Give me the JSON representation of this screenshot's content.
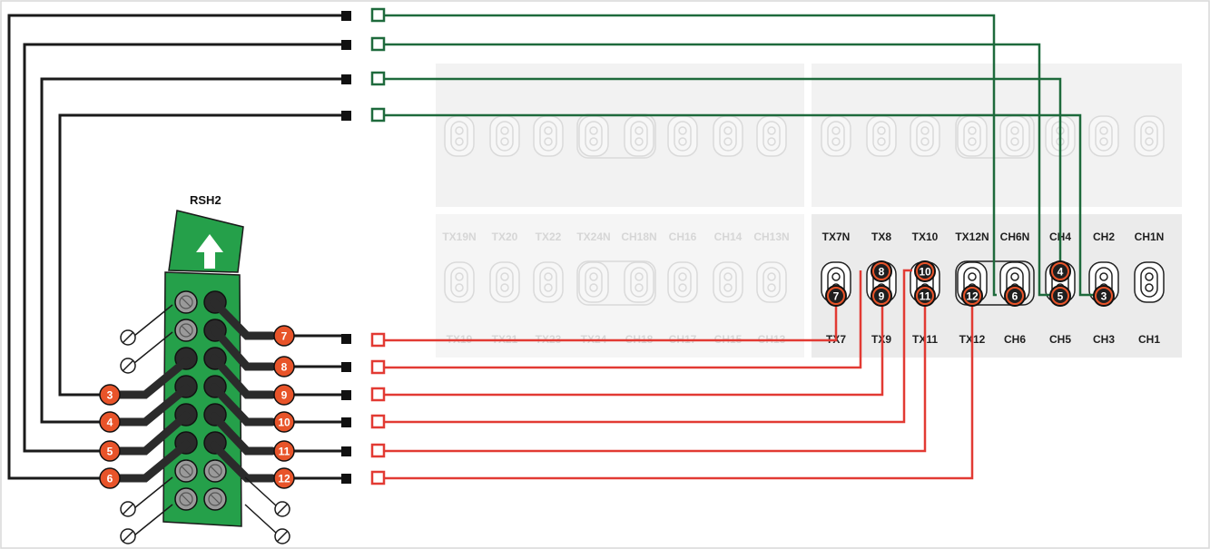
{
  "header_label": "RSH2",
  "colors": {
    "return_wire": "#1e6a3c",
    "send_wire": "#e23a33",
    "harness_wire": "#1a1a1a",
    "badge_orange": "#e8542a",
    "badge_dark": "#222222",
    "connector_green": "#25a04a",
    "panel_bg": "#ececec"
  },
  "panel": {
    "top_row_labels": [
      "TX19N",
      "TX20",
      "TX22",
      "TX24N",
      "CH18N",
      "CH16",
      "CH14",
      "CH13N",
      "TX7N",
      "TX8",
      "TX10",
      "TX12N",
      "CH6N",
      "CH4",
      "CH2",
      "CH1N"
    ],
    "bottom_row_labels": [
      "TX19",
      "TX21",
      "TX23",
      "TX24",
      "CH18",
      "CH17",
      "CH15",
      "CH13",
      "TX7",
      "TX9",
      "TX11",
      "TX12",
      "CH6",
      "CH5",
      "CH3",
      "CH1"
    ]
  },
  "harness_badges": [
    "3",
    "4",
    "5",
    "6",
    "7",
    "8",
    "9",
    "10",
    "11",
    "12"
  ],
  "panel_badges": [
    "7",
    "8",
    "9",
    "10",
    "11",
    "12",
    "6",
    "4",
    "5",
    "3"
  ]
}
